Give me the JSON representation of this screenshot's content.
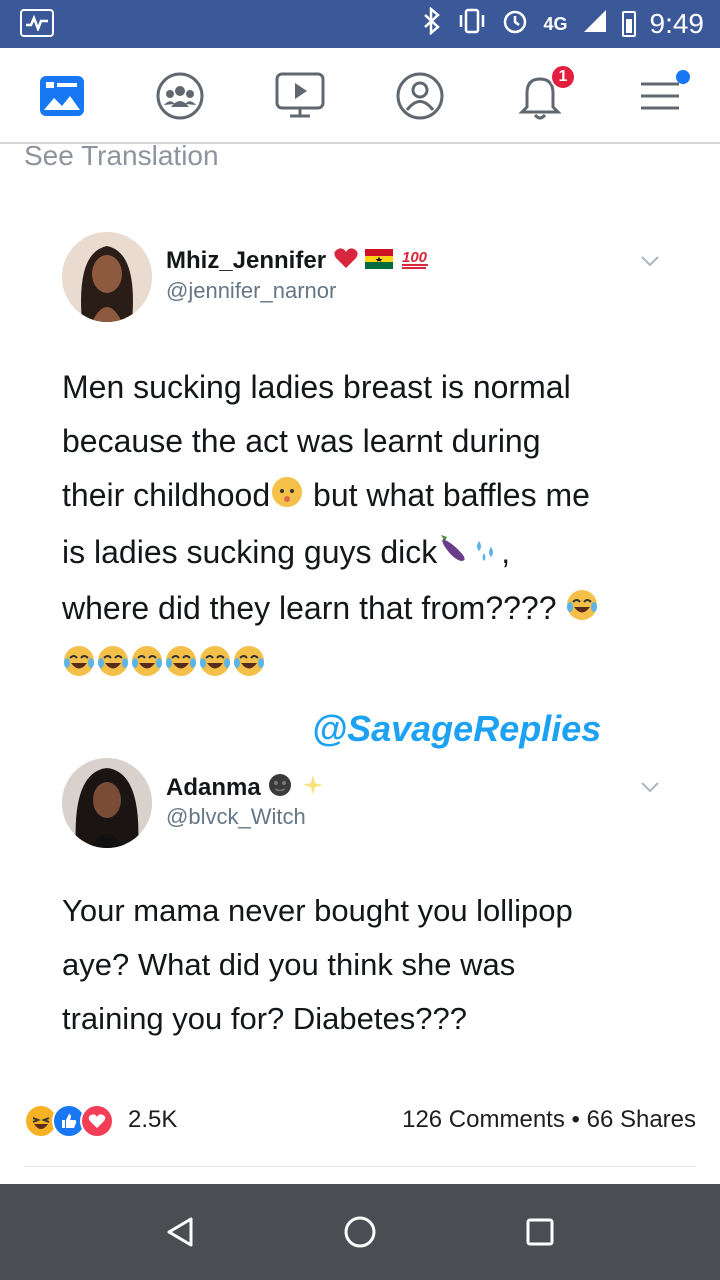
{
  "status_bar": {
    "network": "4G",
    "time": "9:49"
  },
  "nav": {
    "notifications_badge": "1",
    "icons": [
      "news-feed-icon",
      "groups-icon",
      "watch-icon",
      "profile-icon",
      "notifications-icon",
      "menu-icon"
    ]
  },
  "post": {
    "see_translation": "See Translation",
    "tweet1": {
      "name": "Mhiz_Jennifer",
      "handle": "@jennifer_narnor",
      "lines": [
        "Men sucking ladies breast is normal",
        "because the act was learnt during",
        "their childhood",
        "but what baffles me",
        "is ladies sucking guys dick",
        ",",
        "where did they learn that from????"
      ]
    },
    "watermark": "@SavageReplies",
    "tweet2": {
      "name": "Adanma",
      "handle": "@blvck_Witch",
      "lines": [
        "Your mama never bought you lollipop",
        "aye? What did you think she was",
        "training you for? Diabetes???"
      ]
    },
    "reactions": {
      "count": "2.5K",
      "comments": "126 Comments",
      "separator": "•",
      "shares": "66 Shares"
    }
  },
  "colors": {
    "status_bar": "#3b5998",
    "accent_blue": "#1da1f2",
    "badge_red": "#e41e3f",
    "android_nav": "#4a4d52"
  }
}
